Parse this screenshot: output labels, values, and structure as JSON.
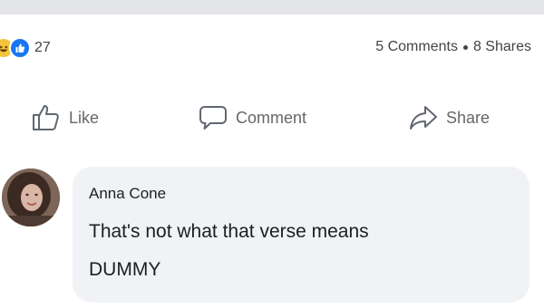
{
  "post": {
    "reaction_count": "27",
    "comments_count": "5 Comments",
    "shares_count": "8 Shares"
  },
  "actions": {
    "like_label": "Like",
    "comment_label": "Comment",
    "share_label": "Share"
  },
  "comment": {
    "author": "Anna Cone",
    "lines": [
      "That's not what that verse means",
      "DUMMY"
    ]
  },
  "icons": {
    "reactions": [
      "haha-reaction-icon",
      "like-reaction-icon"
    ],
    "actions": [
      "thumbs-up-icon",
      "comment-icon",
      "share-icon"
    ]
  },
  "colors": {
    "like_reaction": "#1877f2",
    "haha_reaction": "#f5c33b",
    "action_text": "#65676b",
    "comment_bubble": "#f0f2f5"
  }
}
